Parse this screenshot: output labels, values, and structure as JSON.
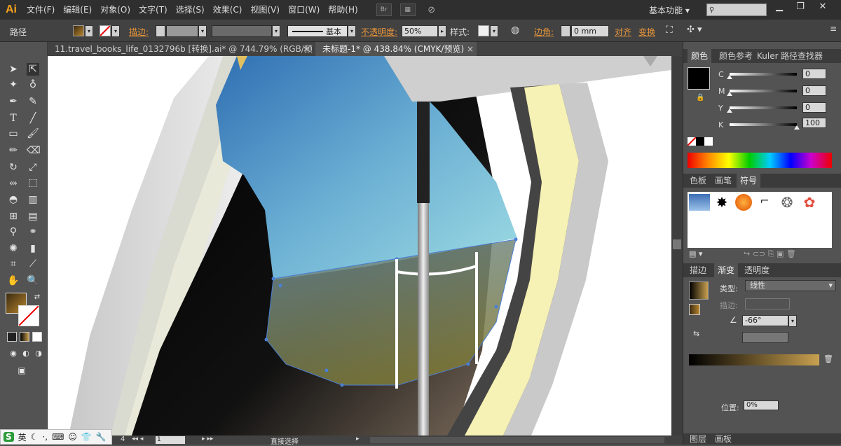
{
  "app": {
    "logo": "Ai"
  },
  "menu": [
    "文件(F)",
    "编辑(E)",
    "对象(O)",
    "文字(T)",
    "选择(S)",
    "效果(C)",
    "视图(V)",
    "窗口(W)",
    "帮助(H)"
  ],
  "menu_extra": {
    "bridge": "Br"
  },
  "workspace": {
    "label": "基本功能"
  },
  "window_buttons": {
    "minimize": "▁",
    "restore": "❐",
    "close": "✕"
  },
  "control": {
    "object_type": "路径",
    "stroke_label": "描边",
    "stroke_style": "基本",
    "opacity_label": "不透明度",
    "opacity_value": "50%",
    "style_label": "样式",
    "corner_label": "边角",
    "corner_value": "0 mm",
    "align_label": "对齐",
    "transform_label": "变换"
  },
  "tabs": [
    {
      "label": "11.travel_books_life_0132796b [转换].ai* @ 744.79% (RGB/预览)",
      "close": "×"
    },
    {
      "label": "未标题-1* @ 438.84% (CMYK/预览)",
      "close": "×"
    }
  ],
  "color_panel": {
    "tabs": [
      "颜色",
      "颜色参考",
      "Kuler",
      "路径查找器"
    ],
    "channels": [
      {
        "name": "C",
        "value": "0",
        "level": 0
      },
      {
        "name": "M",
        "value": "0",
        "level": 0
      },
      {
        "name": "Y",
        "value": "0",
        "level": 0
      },
      {
        "name": "K",
        "value": "100",
        "level": 100
      }
    ]
  },
  "swatch_panel": {
    "tabs": [
      "色板",
      "画笔",
      "符号"
    ]
  },
  "gradient_panel": {
    "tabs": [
      "描边",
      "渐变",
      "透明度"
    ],
    "type_label": "类型:",
    "type_value": "线性",
    "stroke_label": "描边:",
    "angle_value": "-66°",
    "location_label": "位置:",
    "location_value": "0%"
  },
  "bottom_panel": {
    "tabs": [
      "图层",
      "画板"
    ]
  },
  "status": {
    "zoom": "4",
    "page": "1",
    "tool_name": "直接选择"
  },
  "ime": {
    "logo": "S",
    "mode": "英"
  },
  "colors": {
    "accent_orange": "#e8953a",
    "fill_gradient_start": "#7a5a1a",
    "stroke": "#ff0000"
  }
}
